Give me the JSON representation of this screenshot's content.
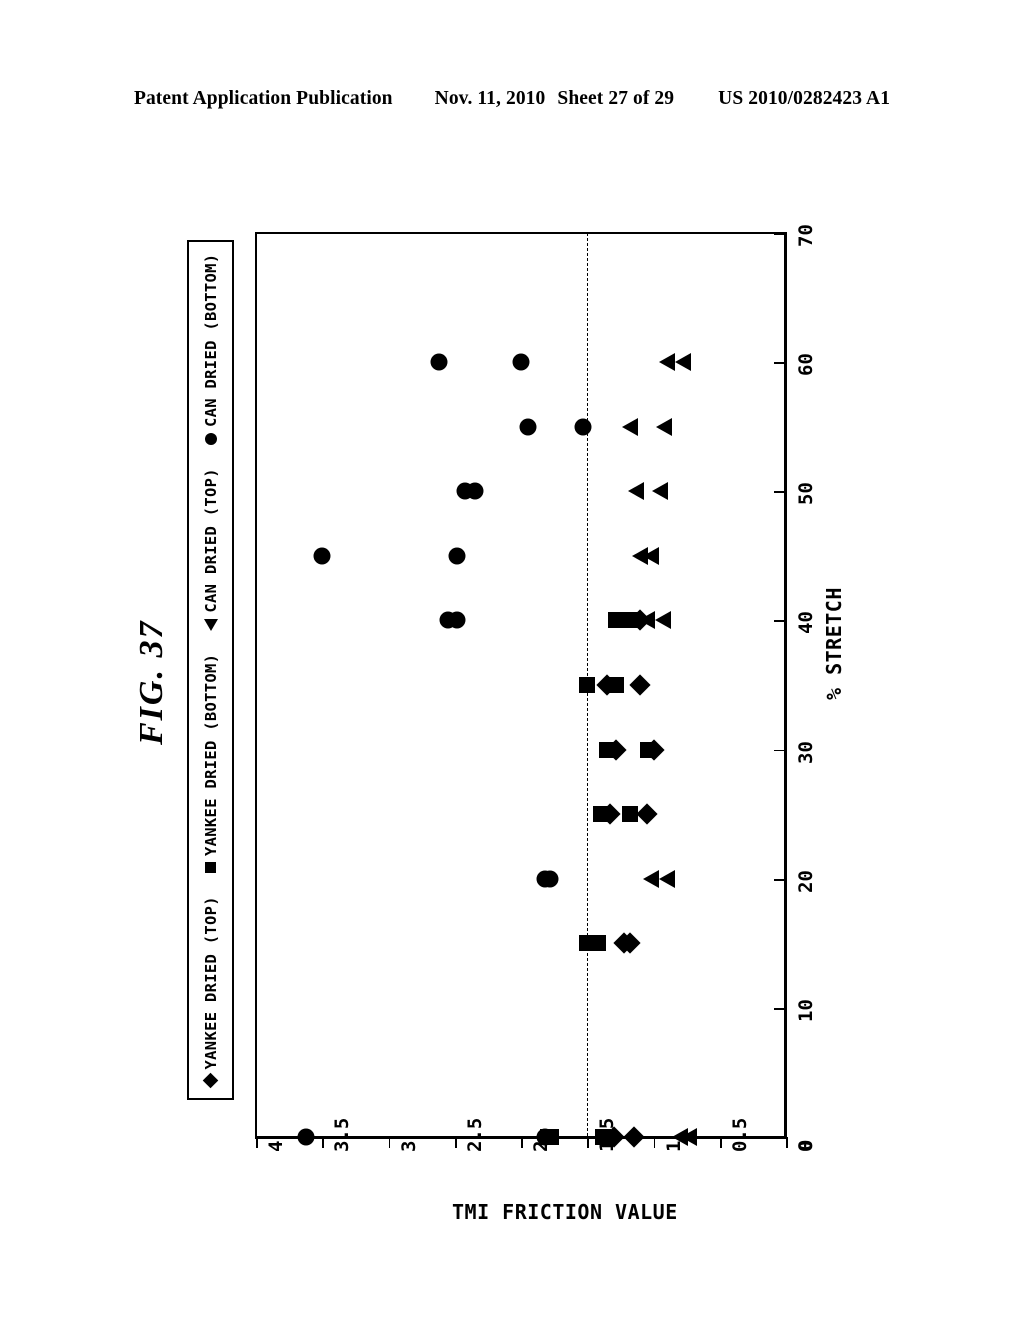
{
  "header": {
    "publication": "Patent Application Publication",
    "date": "Nov. 11, 2010",
    "sheet": "Sheet 27 of 29",
    "document_number": "US 2010/0282423 A1"
  },
  "figure": {
    "title": "FIG. 37"
  },
  "legend": {
    "entries": [
      {
        "marker": "diamond",
        "label": "YANKEE DRIED (TOP)"
      },
      {
        "marker": "square",
        "label": "YANKEE DRIED (BOTTOM)"
      },
      {
        "marker": "triangle",
        "label": "CAN DRIED (TOP)"
      },
      {
        "marker": "circle",
        "label": "CAN DRIED (BOTTOM)"
      }
    ]
  },
  "chart_data": {
    "type": "scatter",
    "title": "FIG. 37",
    "orientation": "rotated-90-ccw",
    "xlabel": "TMI FRICTION VALUE",
    "ylabel": "% STRETCH",
    "xlim": [
      4,
      0
    ],
    "ylim": [
      0,
      70
    ],
    "xticks": [
      "4",
      "3.5",
      "3",
      "2.5",
      "2",
      "1.5",
      "1",
      "0.5",
      "0"
    ],
    "xtick_values": [
      4,
      3.5,
      3,
      2.5,
      2,
      1.5,
      1,
      0.5,
      0
    ],
    "yticks": [
      "0",
      "10",
      "20",
      "30",
      "40",
      "50",
      "60",
      "70"
    ],
    "ytick_values": [
      0,
      10,
      20,
      30,
      40,
      50,
      60,
      70
    ],
    "grid": false,
    "legend_position": "left-outside",
    "reference_line": {
      "axis": "tmi",
      "value": 1.5,
      "style": "dash-dot"
    },
    "series": [
      {
        "name": "YANKEE DRIED (TOP)",
        "marker": "diamond",
        "points": [
          {
            "tmi": 1.3,
            "stretch": 0
          },
          {
            "tmi": 1.15,
            "stretch": 0
          },
          {
            "tmi": 1.22,
            "stretch": 15
          },
          {
            "tmi": 1.18,
            "stretch": 15
          },
          {
            "tmi": 1.33,
            "stretch": 25
          },
          {
            "tmi": 1.05,
            "stretch": 25
          },
          {
            "tmi": 1.28,
            "stretch": 30
          },
          {
            "tmi": 1.0,
            "stretch": 30
          },
          {
            "tmi": 1.35,
            "stretch": 35
          },
          {
            "tmi": 1.1,
            "stretch": 35
          },
          {
            "tmi": 1.1,
            "stretch": 40
          }
        ]
      },
      {
        "name": "YANKEE DRIED (BOTTOM)",
        "marker": "square",
        "points": [
          {
            "tmi": 1.8,
            "stretch": 0
          },
          {
            "tmi": 1.77,
            "stretch": 0
          },
          {
            "tmi": 1.38,
            "stretch": 0
          },
          {
            "tmi": 1.5,
            "stretch": 15
          },
          {
            "tmi": 1.42,
            "stretch": 15
          },
          {
            "tmi": 1.4,
            "stretch": 25
          },
          {
            "tmi": 1.18,
            "stretch": 25
          },
          {
            "tmi": 1.35,
            "stretch": 30
          },
          {
            "tmi": 1.04,
            "stretch": 30
          },
          {
            "tmi": 1.5,
            "stretch": 35
          },
          {
            "tmi": 1.28,
            "stretch": 35
          },
          {
            "tmi": 1.28,
            "stretch": 40
          },
          {
            "tmi": 1.17,
            "stretch": 40
          }
        ]
      },
      {
        "name": "CAN DRIED (TOP)",
        "marker": "triangle",
        "points": [
          {
            "tmi": 0.8,
            "stretch": 0
          },
          {
            "tmi": 0.73,
            "stretch": 0
          },
          {
            "tmi": 1.02,
            "stretch": 20
          },
          {
            "tmi": 0.9,
            "stretch": 20
          },
          {
            "tmi": 1.05,
            "stretch": 40
          },
          {
            "tmi": 0.93,
            "stretch": 40
          },
          {
            "tmi": 1.1,
            "stretch": 45
          },
          {
            "tmi": 1.02,
            "stretch": 45
          },
          {
            "tmi": 1.13,
            "stretch": 50
          },
          {
            "tmi": 0.95,
            "stretch": 50
          },
          {
            "tmi": 1.18,
            "stretch": 55
          },
          {
            "tmi": 0.92,
            "stretch": 55
          },
          {
            "tmi": 0.9,
            "stretch": 60
          },
          {
            "tmi": 0.78,
            "stretch": 60
          }
        ]
      },
      {
        "name": "CAN DRIED (BOTTOM)",
        "marker": "circle",
        "points": [
          {
            "tmi": 3.62,
            "stretch": 0
          },
          {
            "tmi": 1.82,
            "stretch": 0
          },
          {
            "tmi": 1.82,
            "stretch": 20
          },
          {
            "tmi": 1.78,
            "stretch": 20
          },
          {
            "tmi": 2.55,
            "stretch": 40
          },
          {
            "tmi": 2.48,
            "stretch": 40
          },
          {
            "tmi": 3.5,
            "stretch": 45
          },
          {
            "tmi": 2.48,
            "stretch": 45
          },
          {
            "tmi": 2.42,
            "stretch": 50
          },
          {
            "tmi": 2.35,
            "stretch": 50
          },
          {
            "tmi": 1.95,
            "stretch": 55
          },
          {
            "tmi": 1.53,
            "stretch": 55
          },
          {
            "tmi": 2.62,
            "stretch": 60
          },
          {
            "tmi": 2.0,
            "stretch": 60
          }
        ]
      }
    ]
  }
}
